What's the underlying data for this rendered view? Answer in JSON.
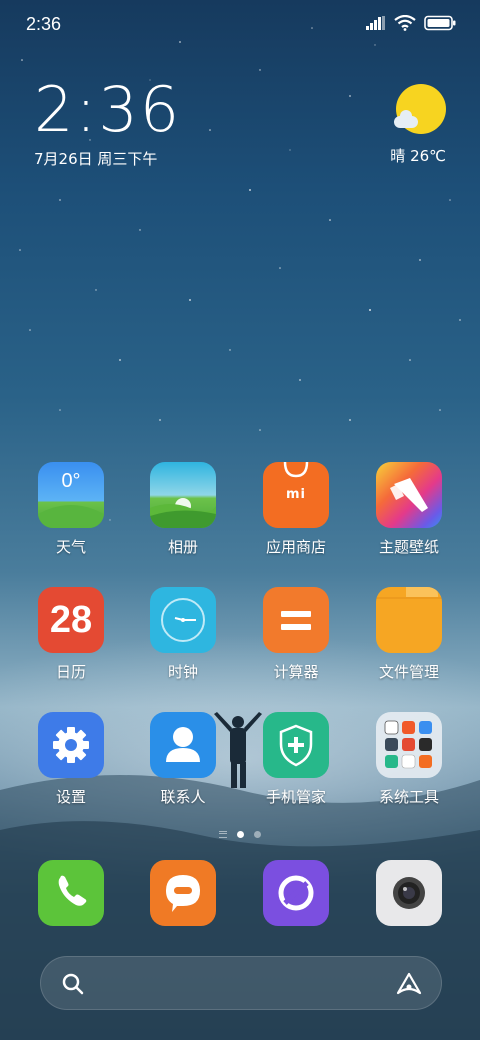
{
  "status_bar": {
    "time": "2:36",
    "icons": [
      "signal-icon",
      "wifi-icon",
      "battery-icon"
    ]
  },
  "clock_widget": {
    "time": "2:36",
    "date": "7月26日 周三下午"
  },
  "weather_widget": {
    "icon": "sunny-partly-cloudy-icon",
    "text": "晴 26℃"
  },
  "apps": [
    {
      "label": "天气",
      "icon": "weather-icon",
      "icon_text": "0°"
    },
    {
      "label": "相册",
      "icon": "gallery-icon"
    },
    {
      "label": "应用商店",
      "icon": "app-store-icon",
      "icon_text": "mi"
    },
    {
      "label": "主题壁纸",
      "icon": "themes-icon"
    },
    {
      "label": "日历",
      "icon": "calendar-icon",
      "icon_text": "28"
    },
    {
      "label": "时钟",
      "icon": "clock-icon"
    },
    {
      "label": "计算器",
      "icon": "calculator-icon"
    },
    {
      "label": "文件管理",
      "icon": "file-manager-icon"
    },
    {
      "label": "设置",
      "icon": "settings-icon"
    },
    {
      "label": "联系人",
      "icon": "contacts-icon"
    },
    {
      "label": "手机管家",
      "icon": "security-icon"
    },
    {
      "label": "系统工具",
      "icon": "system-tools-folder-icon"
    }
  ],
  "page_indicator": {
    "pages": 2,
    "active": 1
  },
  "dock": [
    {
      "icon": "phone-icon",
      "color": "#5cc43a"
    },
    {
      "icon": "messages-icon",
      "color": "#f07a25"
    },
    {
      "icon": "browser-icon",
      "color": "#7b4fe0"
    },
    {
      "icon": "camera-icon",
      "color": "#e8e8ea"
    }
  ],
  "search_bar": {
    "left_icon": "search-icon",
    "right_icon": "assistant-icon"
  },
  "colors": {
    "weather_sky": "#3a8ff0",
    "appstore_orange": "#f36d22",
    "calendar_red": "#e44a33",
    "clock_blue": "#2eb6e0",
    "calculator_orange": "#f27a2c",
    "files_yellow": "#f6a623",
    "settings_blue": "#3e7be8",
    "contacts_blue": "#2a8fe8",
    "security_green": "#27b88a"
  }
}
